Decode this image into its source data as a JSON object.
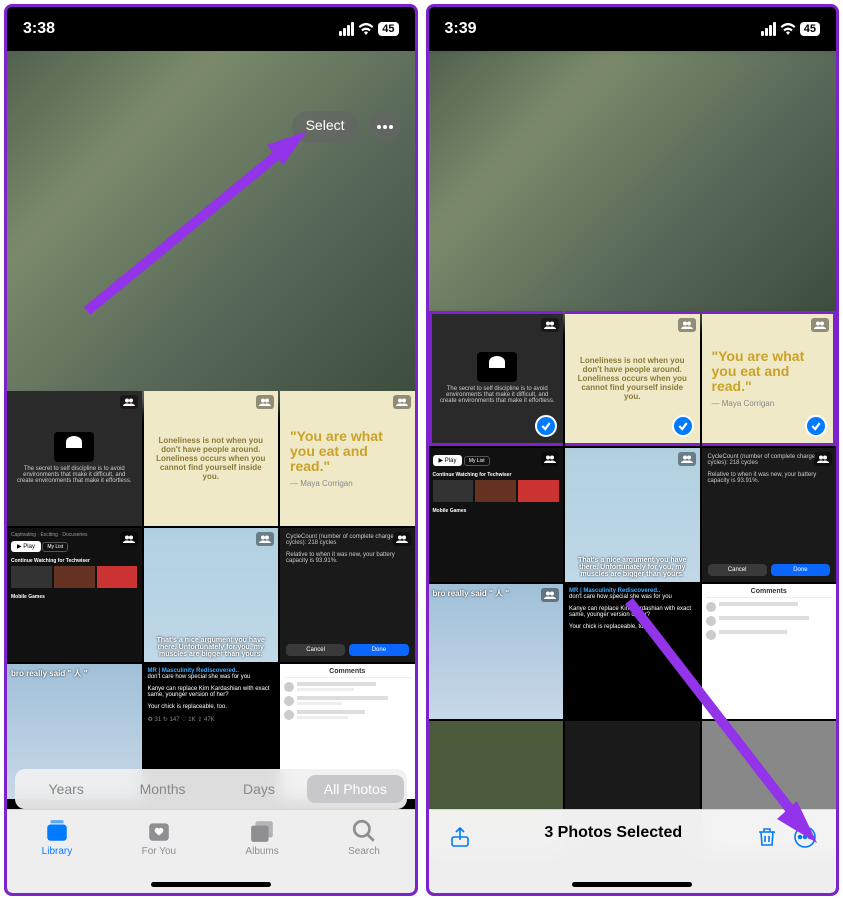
{
  "left": {
    "time": "3:38",
    "battery": "45",
    "select_label": "Select",
    "segments": {
      "years": "Years",
      "months": "Months",
      "days": "Days",
      "all": "All Photos"
    },
    "tabs": {
      "library": "Library",
      "foryou": "For You",
      "albums": "Albums",
      "search": "Search"
    },
    "thumbs": {
      "quote_loneliness": "Loneliness is not when you don't have people around. Loneliness occurs when you cannot find yourself inside you.",
      "quote_youare": "\"You are what you eat and read.\"",
      "quote_author": "— Maya Corrigan",
      "discipline_caption": "The secret to self discipline is to avoid environments that make it difficult, and create environments that make it effortless.",
      "app_continue": "Continue Watching for Techwiser",
      "app_mobile": "Mobile Games",
      "app_play": "▶ Play",
      "app_mylist": "My List",
      "meme_muscles": "That's a nice argument you have there. Unfortunately for you, my muscles are bigger than yours.",
      "cyclecount_title": "CycleCount (number of complete charge cycles): 218 cycles",
      "cyclecount_body": "Relative to when it was new, your battery capacity is 93.91%.",
      "cyclecount_cancel": "Cancel",
      "cyclecount_done": "Done",
      "bro_said": "bro really said \" 人 \"",
      "masculinity_title": "MR | Masculinity Rediscovered..",
      "masculinity_l1": "don't care how special she was for you",
      "masculinity_l2": "Kanye can replace Kim Kardashian with exact same, younger version of her?",
      "masculinity_l3": "Your chick is replaceable, too.",
      "comments_title": "Comments"
    }
  },
  "right": {
    "time": "3:39",
    "battery": "45",
    "selection_title": "3 Photos Selected",
    "thumbs": {
      "quote_loneliness": "Loneliness is not when you don't have people around. Loneliness occurs when you cannot find yourself inside you.",
      "quote_youare": "\"You are what you eat and read.\"",
      "quote_author": "— Maya Corrigan",
      "discipline_caption": "The secret to self discipline is to avoid environments that make it difficult, and create environments that make it effortless.",
      "app_continue": "Continue Watching for Techwiser",
      "app_mobile": "Mobile Games",
      "app_play": "▶ Play",
      "app_mylist": "My List",
      "meme_muscles": "That's a nice argument you have there. Unfortunately for you, my muscles are bigger than yours.",
      "cyclecount_title": "CycleCount (number of complete charge cycles): 218 cycles",
      "cyclecount_body": "Relative to when it was new, your battery capacity is 93.91%.",
      "cyclecount_cancel": "Cancel",
      "cyclecount_done": "Done",
      "bro_said": "bro really said \" 人 \"",
      "masculinity_title": "MR | Masculinity Rediscovered..",
      "masculinity_l1": "don't care how special she was for you",
      "masculinity_l2": "Kanye can replace Kim Kardashian with exact same, younger version of her?",
      "masculinity_l3": "Your chick is replaceable, too.",
      "comments_title": "Comments"
    }
  }
}
